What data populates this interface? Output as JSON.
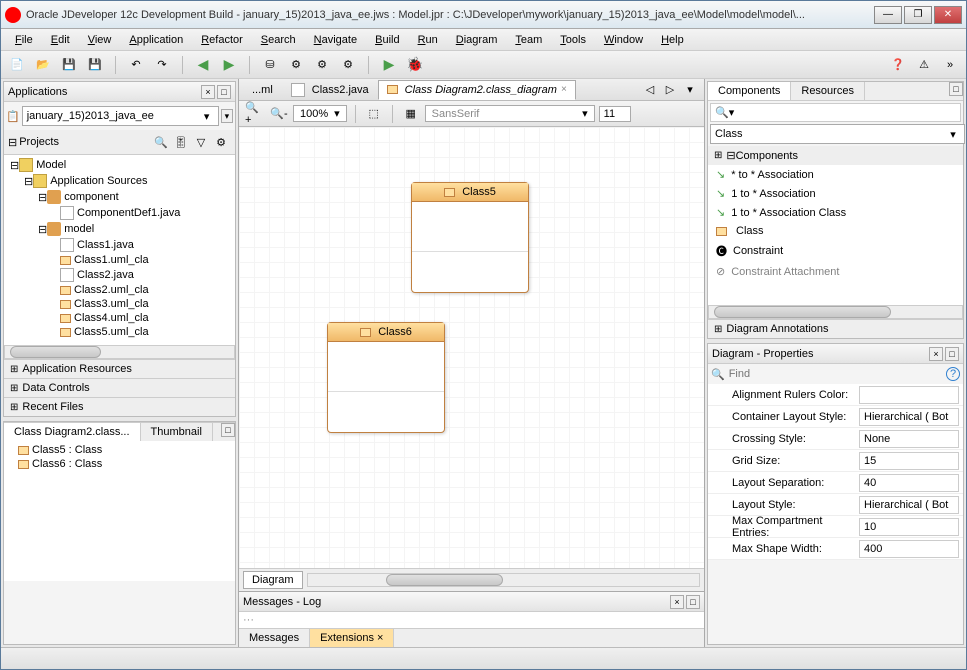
{
  "title": "Oracle JDeveloper 12c Development Build - january_15)2013_java_ee.jws : Model.jpr : C:\\JDeveloper\\mywork\\january_15)2013_java_ee\\Model\\model\\model\\...",
  "menu": [
    "File",
    "Edit",
    "View",
    "Application",
    "Refactor",
    "Search",
    "Navigate",
    "Build",
    "Run",
    "Diagram",
    "Team",
    "Tools",
    "Window",
    "Help"
  ],
  "apps": {
    "title": "Applications",
    "selected": "january_15)2013_java_ee",
    "projects_label": "Projects",
    "tree": {
      "root": "Model",
      "app_src": "Application Sources",
      "component": "component",
      "compdef": "ComponentDef1.java",
      "model": "model",
      "files": [
        "Class1.java",
        "Class1.uml_cla",
        "Class2.java",
        "Class2.uml_cla",
        "Class3.uml_cla",
        "Class4.uml_cla",
        "Class5.uml_cla"
      ]
    },
    "sections": [
      "Application Resources",
      "Data Controls",
      "Recent Files"
    ]
  },
  "structure": {
    "tab1": "Class Diagram2.class...",
    "tab2": "Thumbnail",
    "items": [
      "Class5 : Class",
      "Class6 : Class"
    ]
  },
  "editor": {
    "tab1": "...ml",
    "tab2": "Class2.java",
    "tab3": "Class Diagram2.class_diagram",
    "zoom": "100%",
    "font": "SansSerif",
    "fontsize": "11",
    "class5": "Class5",
    "class6": "Class6",
    "diagram_tab": "Diagram"
  },
  "messages": {
    "title": "Messages - Log",
    "tab1": "Messages",
    "tab2": "Extensions"
  },
  "components": {
    "tab1": "Components",
    "tab2": "Resources",
    "category": "Class",
    "group": "Components",
    "items": [
      "* to * Association",
      "1 to * Association",
      "1 to * Association Class",
      "Class",
      "Constraint",
      "Constraint Attachment"
    ],
    "group2": "Diagram Annotations"
  },
  "properties": {
    "title": "Diagram - Properties",
    "find_ph": "Find",
    "rows": [
      {
        "label": "Alignment Rulers Color:",
        "value": ""
      },
      {
        "label": "Container Layout Style:",
        "value": "Hierarchical ( Bot"
      },
      {
        "label": "Crossing Style:",
        "value": "None"
      },
      {
        "label": "Grid Size:",
        "value": "15"
      },
      {
        "label": "Layout Separation:",
        "value": "40"
      },
      {
        "label": "Layout Style:",
        "value": "Hierarchical ( Bot"
      },
      {
        "label": "Max Compartment Entries:",
        "value": "10"
      },
      {
        "label": "Max Shape Width:",
        "value": "400"
      }
    ]
  }
}
